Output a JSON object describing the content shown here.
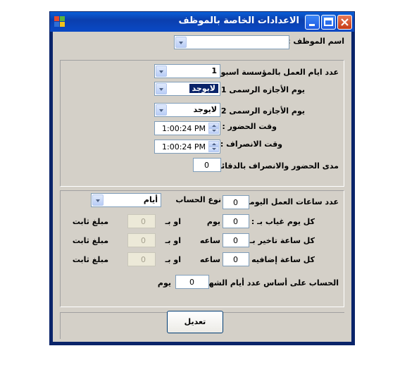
{
  "window": {
    "title": "الاعدادات الخاصة بالموظف",
    "icons": [
      "app-icon",
      "minimize-icon",
      "maximize-icon",
      "close-icon"
    ]
  },
  "employee": {
    "label": "اسم الموظف :",
    "value": ""
  },
  "work": {
    "days_label": "عدد ايام العمل بالمؤسسة اسبوعياً :",
    "days_value": "1",
    "holiday1_label": "يوم الأجازه الرسمى 1 :",
    "holiday1_value": "لايوجد",
    "holiday2_label": "يوم الأجازه الرسمى 2 :",
    "holiday2_value": "لايوجد",
    "attend_label": "وقت الحضور :",
    "attend_value": "1:00:24 PM",
    "leave_label": "وقت الانصراف :",
    "leave_value": "1:00:24 PM",
    "range_label": "مدى الحضور والانصراف بالدقائق :",
    "range_value": "0"
  },
  "calc": {
    "daily_hours_label": "عدد ساعات العمل اليوميه :",
    "daily_hours_value": "0",
    "calc_type_label": "نوع الحساب",
    "calc_type_value": "أيام",
    "absence_label": "كل يوم غياب بـ :",
    "absence_value": "0",
    "absence_unit": "يوم",
    "overtime_late_label": "كل ساعة تاخير بـ :",
    "late_value": "0",
    "late_unit": "ساعه",
    "extra_label": "كل ساعة إضافيه بـ :",
    "extra_value": "0",
    "extra_unit": "ساعه",
    "or_label": "او بـ",
    "fixed_label": "مبلغ ثابت",
    "fixed1": "0",
    "fixed2": "0",
    "fixed3": "0",
    "month_label": "الحساب على أساس عدد أيام الشهر :",
    "month_value": "0",
    "month_unit": "يوم"
  },
  "actions": {
    "edit_label": "تعديل"
  }
}
